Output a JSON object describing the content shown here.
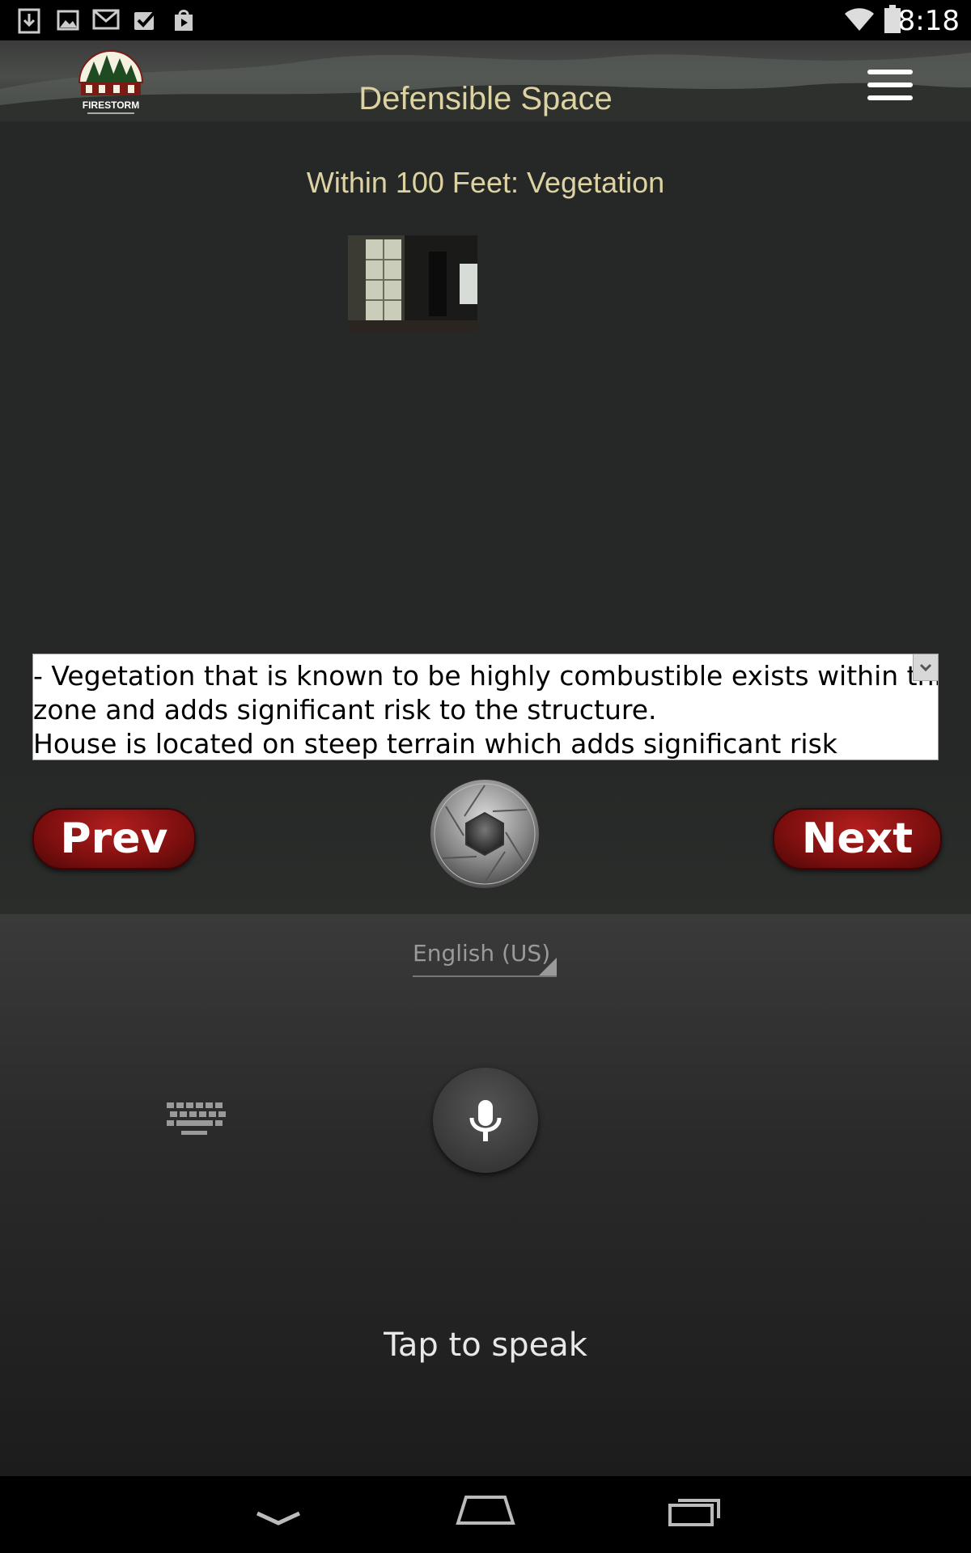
{
  "status_bar": {
    "time": "8:18",
    "notification_icons": [
      "download-icon",
      "image-icon",
      "gmail-icon",
      "checkbox-icon",
      "play-store-icon"
    ],
    "status_icons": [
      "wifi-icon",
      "battery-icon"
    ]
  },
  "header": {
    "logo_text": "FIRESTORM",
    "title": "Defensible Space"
  },
  "main": {
    "section_title": "Within 100 Feet: Vegetation",
    "notes": {
      "line1": " - Vegetation that is known to be highly combustible exists within this",
      "line2": "zone and adds significant risk to the structure.",
      "line3": "House is located on steep terrain which adds significant risk"
    },
    "prev_label": "Prev",
    "next_label": "Next"
  },
  "voice": {
    "language": "English (US)",
    "tap_label": "Tap to speak"
  },
  "colors": {
    "title_color": "#ddd3a2",
    "button_red": "#8b1212",
    "background": "#262827"
  }
}
